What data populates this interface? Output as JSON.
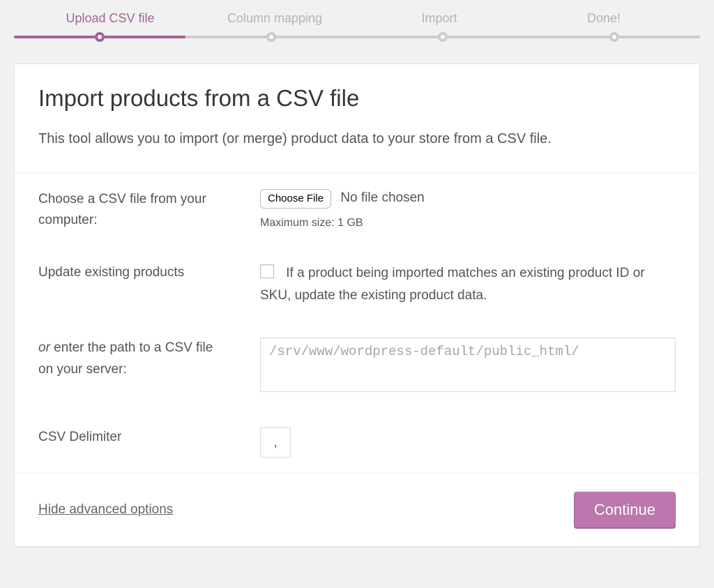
{
  "stepper": {
    "steps": [
      {
        "label": "Upload CSV file",
        "active": true
      },
      {
        "label": "Column mapping",
        "active": false
      },
      {
        "label": "Import",
        "active": false
      },
      {
        "label": "Done!",
        "active": false
      }
    ]
  },
  "header": {
    "title": "Import products from a CSV file",
    "subtitle": "This tool allows you to import (or merge) product data to your store from a CSV file."
  },
  "form": {
    "choose_file_label": "Choose a CSV file from your computer:",
    "choose_file_button": "Choose File",
    "choose_file_status": "No file chosen",
    "max_size_text": "Maximum size: 1 GB",
    "update_label": "Update existing products",
    "update_help": "If a product being imported matches an existing product ID or SKU, update the existing product data.",
    "update_checked": false,
    "path_prefix_italic": "or",
    "path_label_rest": " enter the path to a CSV file on your server:",
    "path_placeholder": "/srv/www/wordpress-default/public_html/",
    "path_value": "",
    "delimiter_label": "CSV Delimiter",
    "delimiter_value": ","
  },
  "footer": {
    "advanced_link": "Hide advanced options",
    "continue_button": "Continue"
  }
}
